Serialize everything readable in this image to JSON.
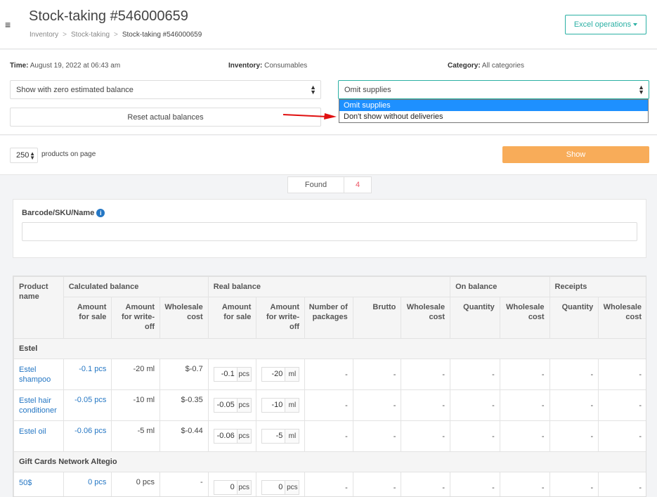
{
  "header": {
    "menu_glyph": "≡",
    "title": "Stock-taking #546000659",
    "breadcrumb": [
      "Inventory",
      "Stock-taking",
      "Stock-taking #546000659"
    ],
    "excel_button": "Excel operations"
  },
  "filters": {
    "time_label": "Time:",
    "time_value": "August 19, 2022 at 06:43 am",
    "inventory_label": "Inventory:",
    "inventory_value": "Consumables",
    "category_label": "Category:",
    "category_value": "All categories",
    "balance_select": "Show with zero estimated balance",
    "supplies_select": "Omit supplies",
    "reset_button": "Reset actual balances",
    "dropdown_options": [
      "Omit supplies",
      "Don't show without deliveries"
    ]
  },
  "pager": {
    "per_page": "250",
    "per_page_label": "products on page",
    "show_button": "Show"
  },
  "found": {
    "label": "Found",
    "count": "4"
  },
  "search": {
    "label": "Barcode/SKU/Name",
    "info_glyph": "i"
  },
  "table": {
    "group_headers": [
      "Product name",
      "Calculated balance",
      "Real balance",
      "On balance",
      "Receipts"
    ],
    "sub_headers": [
      "Amount for sale",
      "Amount for write-off",
      "Wholesale cost",
      "Amount for sale",
      "Amount for write-off",
      "Number of packages",
      "Brutto",
      "Wholesale cost",
      "Quantity",
      "Wholesale cost",
      "Quantity",
      "Wholesale cost"
    ],
    "groups": [
      {
        "name": "Estel",
        "rows": [
          {
            "name": "Estel shampoo",
            "calc_sale": "-0.1 pcs",
            "calc_writeoff": "-20 ml",
            "wholesale": "$-0.7",
            "real_sale": "-0.1",
            "real_sale_unit": "pcs",
            "real_writeoff": "-20",
            "real_writeoff_unit": "ml",
            "packages": "-",
            "brutto": "-",
            "real_cost": "-",
            "on_qty": "-",
            "on_cost": "-",
            "rec_qty": "-",
            "rec_cost": "-"
          },
          {
            "name": "Estel hair conditioner",
            "calc_sale": "-0.05 pcs",
            "calc_writeoff": "-10 ml",
            "wholesale": "$-0.35",
            "real_sale": "-0.05",
            "real_sale_unit": "pcs",
            "real_writeoff": "-10",
            "real_writeoff_unit": "ml",
            "packages": "-",
            "brutto": "-",
            "real_cost": "-",
            "on_qty": "-",
            "on_cost": "-",
            "rec_qty": "-",
            "rec_cost": "-"
          },
          {
            "name": "Estel oil",
            "calc_sale": "-0.06 pcs",
            "calc_writeoff": "-5 ml",
            "wholesale": "$-0.44",
            "real_sale": "-0.06",
            "real_sale_unit": "pcs",
            "real_writeoff": "-5",
            "real_writeoff_unit": "ml",
            "packages": "-",
            "brutto": "-",
            "real_cost": "-",
            "on_qty": "-",
            "on_cost": "-",
            "rec_qty": "-",
            "rec_cost": "-"
          }
        ]
      },
      {
        "name": "Gift Cards Network Altegio",
        "rows": [
          {
            "name": "50$",
            "calc_sale": "0 pcs",
            "calc_writeoff": "0 pcs",
            "wholesale": "-",
            "real_sale": "0",
            "real_sale_unit": "pcs",
            "real_writeoff": "0",
            "real_writeoff_unit": "pcs",
            "packages": "-",
            "brutto": "-",
            "real_cost": "-",
            "on_qty": "-",
            "on_cost": "-",
            "rec_qty": "-",
            "rec_cost": "-"
          }
        ]
      }
    ]
  },
  "colors": {
    "accent": "#2bb0a4",
    "show_button": "#f8ac59",
    "link": "#2577c4",
    "arrow": "#e01010",
    "dropdown_selected": "#1e90ff"
  }
}
